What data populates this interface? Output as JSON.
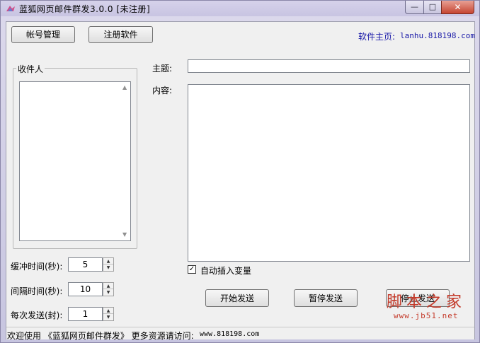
{
  "window": {
    "title": "蓝狐网页邮件群发3.0.0 [未注册]",
    "controls": {
      "minimize": "—",
      "maximize": "□",
      "close": "✕"
    }
  },
  "toolbar": {
    "account_button": "帐号管理",
    "register_button": "注册软件",
    "homepage_label": "软件主页:",
    "homepage_url": "lanhu.818198.com"
  },
  "recipients": {
    "group_label": "收件人",
    "items": []
  },
  "compose": {
    "subject_label": "主题:",
    "subject_value": "",
    "content_label": "内容:",
    "content_value": "",
    "auto_insert_label": "自动插入变量",
    "auto_insert_checked": true
  },
  "settings": {
    "buffer_label": "缓冲时间(秒):",
    "buffer_value": "5",
    "interval_label": "间隔时间(秒):",
    "interval_value": "10",
    "per_send_label": "每次发送(封):",
    "per_send_value": "1"
  },
  "actions": {
    "start": "开始发送",
    "pause": "暂停发送",
    "stop": "停止发送"
  },
  "statusbar": {
    "text": "欢迎使用 《蓝狐网页邮件群发》 更多资源请访问:",
    "url": "www.818198.com"
  },
  "watermark": {
    "text": "脚本之家",
    "url": "www.jb51.net"
  },
  "icons": {
    "app": "app-icon",
    "checkbox": "checkmark-icon",
    "spin_up": "chevron-up-icon",
    "spin_down": "chevron-down-icon"
  }
}
